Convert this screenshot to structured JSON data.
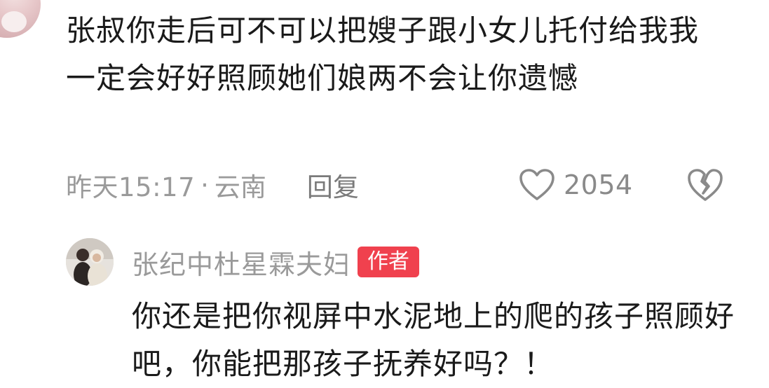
{
  "comment": {
    "text": "张叔你走后可不可以把嫂子跟小女儿托付给我我一定会好好照顾她们娘两不会让你遗憾",
    "time": "昨天15:17",
    "separator": "·",
    "location": "云南",
    "reply_label": "回复",
    "like_count": "2054"
  },
  "reply": {
    "author": "张纪中杜星霖夫妇",
    "badge": "作者",
    "text": "你还是把你视屏中水泥地上的爬的孩子照顾好吧，你能把那孩子抚养好吗？！"
  },
  "icons": {
    "like": "heart-outline-icon",
    "dislike": "broken-heart-icon"
  },
  "colors": {
    "badge": "#f0414e",
    "meta_text": "#9a9a9a",
    "body_text": "#1a1a1a"
  }
}
